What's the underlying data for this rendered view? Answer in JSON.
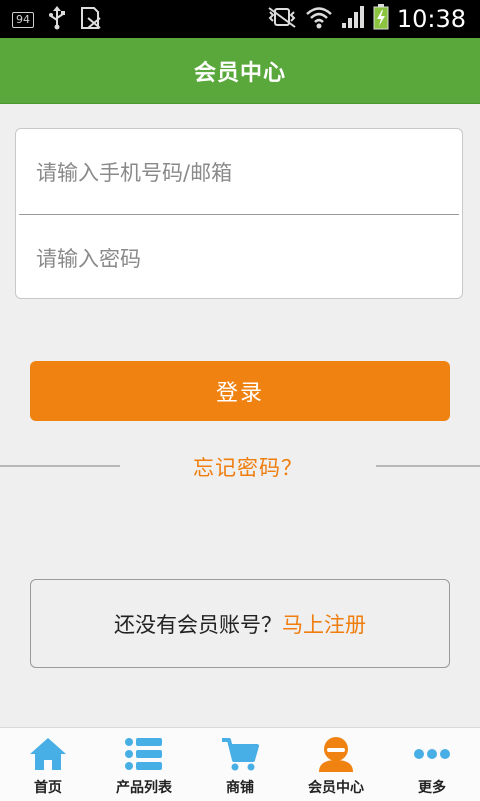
{
  "status_bar": {
    "notification_badge": "94",
    "time": "10:38"
  },
  "header": {
    "title": "会员中心"
  },
  "login": {
    "phone_placeholder": "请输入手机号码/邮箱",
    "password_placeholder": "请输入密码",
    "login_label": "登录"
  },
  "forgot": {
    "label": "忘记密码？"
  },
  "register": {
    "prompt": "还没有会员账号？",
    "link": "马上注册"
  },
  "tabs": [
    {
      "label": "首页",
      "icon": "home-icon"
    },
    {
      "label": "产品列表",
      "icon": "list-icon"
    },
    {
      "label": "商铺",
      "icon": "cart-icon"
    },
    {
      "label": "会员中心",
      "icon": "member-icon"
    },
    {
      "label": "更多",
      "icon": "more-icon"
    }
  ],
  "colors": {
    "header_green": "#5aa83b",
    "accent_orange": "#f08212",
    "tab_icon_blue": "#48aee6",
    "battery_green": "#8bc43f"
  }
}
